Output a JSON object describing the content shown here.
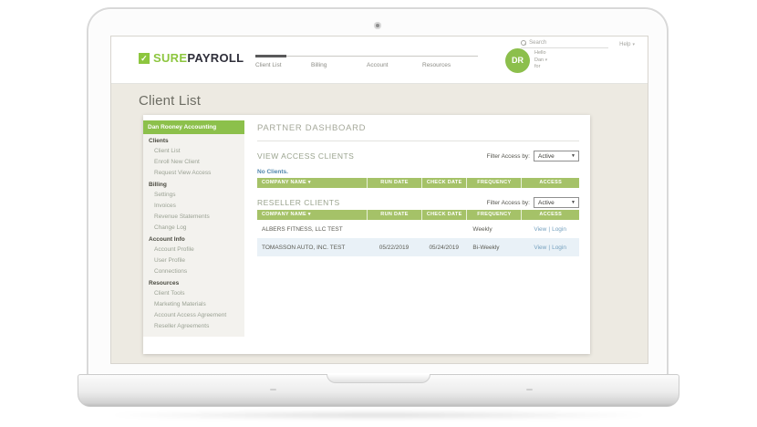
{
  "brand": {
    "sure": "SURE",
    "payroll": "PAYROLL",
    "check": "✓"
  },
  "header": {
    "search_placeholder": "Search",
    "help_label": "Help",
    "nav": [
      {
        "label": "Client List",
        "active": true
      },
      {
        "label": "Billing",
        "active": false
      },
      {
        "label": "Account",
        "active": false
      },
      {
        "label": "Resources",
        "active": false
      }
    ],
    "user": {
      "initials": "DR",
      "greeting_lines": [
        "Hello",
        "Dan",
        "for"
      ]
    }
  },
  "page": {
    "title": "Client List"
  },
  "sidebar": {
    "selected": "Dan Rooney Accounting",
    "sections": [
      {
        "title": "Clients",
        "items": [
          "Client List",
          "Enroll New Client",
          "Request View Access"
        ]
      },
      {
        "title": "Billing",
        "items": [
          "Settings",
          "Invoices",
          "Revenue Statements",
          "Change Log"
        ]
      },
      {
        "title": "Account Info",
        "items": [
          "Account Profile",
          "User Profile",
          "Connections"
        ]
      },
      {
        "title": "Resources",
        "items": [
          "Client Tools",
          "Marketing Materials",
          "Account Access Agreement",
          "Reseller Agreements"
        ]
      }
    ]
  },
  "main": {
    "heading": "PARTNER DASHBOARD",
    "table_columns": {
      "company": "COMPANY NAME",
      "run_date": "RUN DATE",
      "check_date": "CHECK DATE",
      "frequency": "FREQUENCY",
      "access": "ACCESS"
    },
    "sections": [
      {
        "title": "VIEW ACCESS CLIENTS",
        "filter_label": "Filter Access by:",
        "filter_value": "Active",
        "empty_message": "No Clients.",
        "rows": []
      },
      {
        "title": "RESELLER CLIENTS",
        "filter_label": "Filter Access by:",
        "filter_value": "Active",
        "rows": [
          {
            "company": "ALBERS FITNESS, LLC TEST",
            "run_date": "",
            "check_date": "",
            "frequency": "Weekly",
            "access_view": "View",
            "access_sep": "|",
            "access_login": "Login"
          },
          {
            "company": "TOMASSON AUTO, INC. TEST",
            "run_date": "05/22/2019",
            "check_date": "05/24/2019",
            "frequency": "Bi-Weekly",
            "access_view": "View",
            "access_sep": "|",
            "access_login": "Login"
          }
        ]
      }
    ]
  },
  "icons": {
    "sort_arrow": "▾",
    "dropdown_arrow": "▼",
    "help_caret": "▾",
    "user_caret": "▾"
  },
  "colors": {
    "brand_green": "#8dc63f",
    "sidebar_selected_green": "#8cc04b",
    "table_header_green": "#a5c268",
    "link_blue": "#76a1bf",
    "empty_message_blue": "#4f86ac",
    "page_background_beige": "#edeae2",
    "row_highlight_blue": "#e9f1f7",
    "logo_dark": "#2f2f3a"
  }
}
